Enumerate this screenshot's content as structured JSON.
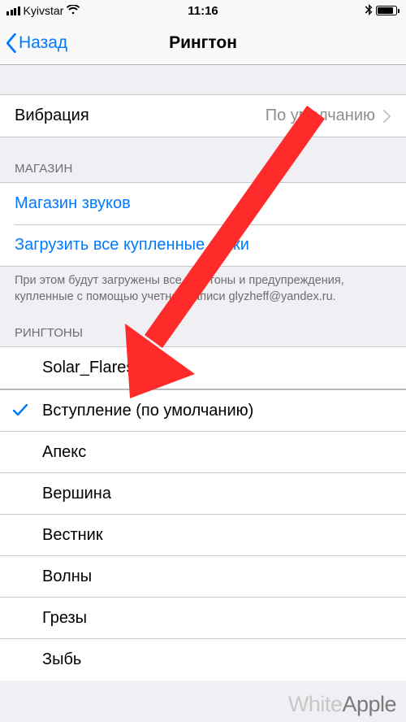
{
  "status": {
    "carrier": "Kyivstar",
    "time": "11:16"
  },
  "nav": {
    "back_label": "Назад",
    "title": "Рингтон"
  },
  "vibration": {
    "label": "Вибрация",
    "value": "По умолчанию"
  },
  "store": {
    "header": "МАГАЗИН",
    "sounds_store": "Магазин звуков",
    "download_all": "Загрузить все купленные звуки",
    "footer": "При этом будут загружены все рингтоны и предупреждения, купленные с помощью учетной записи glyzheff@yandex.ru."
  },
  "ringtones": {
    "header": "РИНГТОНЫ",
    "custom": [
      "Solar_Flares"
    ],
    "builtin": [
      {
        "label": "Вступление (по умолчанию)",
        "checked": true
      },
      {
        "label": "Апекс",
        "checked": false
      },
      {
        "label": "Вершина",
        "checked": false
      },
      {
        "label": "Вестник",
        "checked": false
      },
      {
        "label": "Волны",
        "checked": false
      },
      {
        "label": "Грезы",
        "checked": false
      },
      {
        "label": "Зыбь",
        "checked": false
      }
    ]
  },
  "watermark": {
    "part1": "White",
    "part2": "Apple"
  },
  "annotation": {
    "color": "#ff2a2a"
  }
}
